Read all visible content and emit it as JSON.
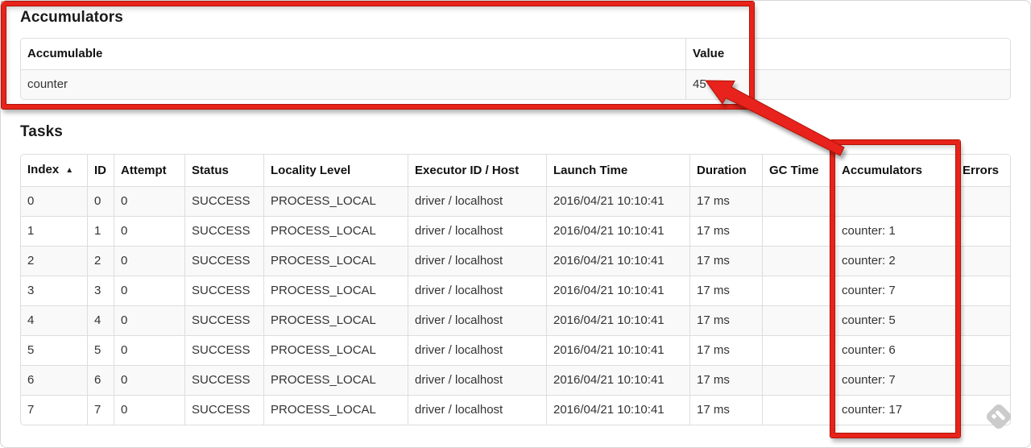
{
  "theme": {
    "annotation_red": "#e8231a",
    "table_border": "#dddddd",
    "row_stripe": "#f9f9f9"
  },
  "accumulators_section": {
    "title": "Accumulators",
    "table": {
      "headers": [
        "Accumulable",
        "Value"
      ],
      "rows": [
        {
          "accumulable": "counter",
          "value": "45"
        }
      ]
    }
  },
  "tasks_section": {
    "title": "Tasks",
    "table": {
      "columns": [
        "Index",
        "ID",
        "Attempt",
        "Status",
        "Locality Level",
        "Executor ID / Host",
        "Launch Time",
        "Duration",
        "GC Time",
        "Accumulators",
        "Errors"
      ],
      "sort_icon": "▲",
      "sorted_column": "Index",
      "rows": [
        [
          "0",
          "0",
          "0",
          "SUCCESS",
          "PROCESS_LOCAL",
          "driver / localhost",
          "2016/04/21 10:10:41",
          "17 ms",
          "",
          "",
          ""
        ],
        [
          "1",
          "1",
          "0",
          "SUCCESS",
          "PROCESS_LOCAL",
          "driver / localhost",
          "2016/04/21 10:10:41",
          "17 ms",
          "",
          "counter: 1",
          ""
        ],
        [
          "2",
          "2",
          "0",
          "SUCCESS",
          "PROCESS_LOCAL",
          "driver / localhost",
          "2016/04/21 10:10:41",
          "17 ms",
          "",
          "counter: 2",
          ""
        ],
        [
          "3",
          "3",
          "0",
          "SUCCESS",
          "PROCESS_LOCAL",
          "driver / localhost",
          "2016/04/21 10:10:41",
          "17 ms",
          "",
          "counter: 7",
          ""
        ],
        [
          "4",
          "4",
          "0",
          "SUCCESS",
          "PROCESS_LOCAL",
          "driver / localhost",
          "2016/04/21 10:10:41",
          "17 ms",
          "",
          "counter: 5",
          ""
        ],
        [
          "5",
          "5",
          "0",
          "SUCCESS",
          "PROCESS_LOCAL",
          "driver / localhost",
          "2016/04/21 10:10:41",
          "17 ms",
          "",
          "counter: 6",
          ""
        ],
        [
          "6",
          "6",
          "0",
          "SUCCESS",
          "PROCESS_LOCAL",
          "driver / localhost",
          "2016/04/21 10:10:41",
          "17 ms",
          "",
          "counter: 7",
          ""
        ],
        [
          "7",
          "7",
          "0",
          "SUCCESS",
          "PROCESS_LOCAL",
          "driver / localhost",
          "2016/04/21 10:10:41",
          "17 ms",
          "",
          "counter: 17",
          ""
        ]
      ]
    }
  },
  "annotations": {
    "boxes": [
      {
        "target": "accumulators-section"
      },
      {
        "target": "accumulators-column"
      }
    ],
    "arrow": {
      "from": "accumulators-column",
      "to": "accumulator-value"
    }
  },
  "watermark": {
    "icon": "feedly-badge-icon"
  }
}
